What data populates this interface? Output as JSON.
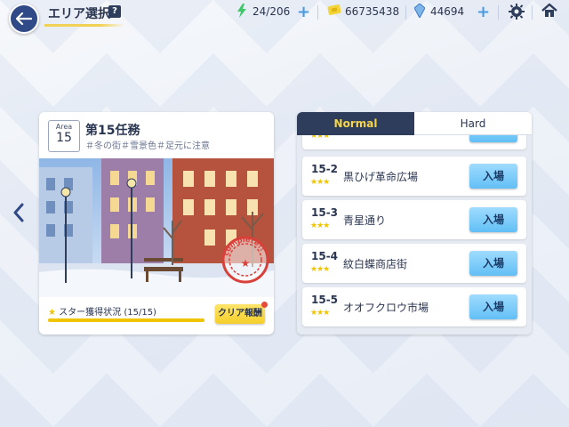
{
  "header": {
    "title": "エリア選択",
    "help_label": "?",
    "stamina": "24/206",
    "credits": "66735438",
    "gems": "44694"
  },
  "area": {
    "area_label": "Area",
    "area_number": "15",
    "title": "第15任務",
    "tags": "＃冬の街＃雪景色＃足元に注意",
    "stamp_text": "complete!!",
    "star_status": "スター獲得状況 (15/15)",
    "star_progress_fraction": 1.0,
    "reward_label": "クリア報酬"
  },
  "tabs": {
    "normal": "Normal",
    "hard": "Hard"
  },
  "stages": [
    {
      "no": "15-2",
      "name": "黒ひげ革命広場",
      "stars": "★★★",
      "enter": "入場"
    },
    {
      "no": "15-3",
      "name": "青星通り",
      "stars": "★★★",
      "enter": "入場"
    },
    {
      "no": "15-4",
      "name": "紋白蝶商店街",
      "stars": "★★★",
      "enter": "入場"
    },
    {
      "no": "15-5",
      "name": "オオフクロウ市場",
      "stars": "★★★",
      "enter": "入場"
    }
  ],
  "partial_stage": {
    "stars": "★★★"
  },
  "colors": {
    "accent_dark": "#2f3d5c",
    "tab_active_text": "#f5d54a",
    "enter_button": "#62bff5",
    "reward_button": "#f5cf2b"
  }
}
